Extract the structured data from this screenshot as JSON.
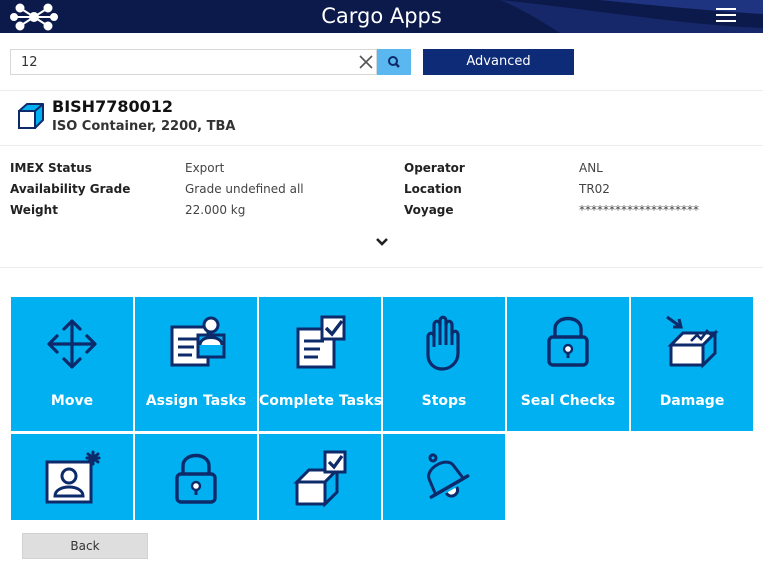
{
  "header": {
    "title": "Cargo Apps"
  },
  "search": {
    "value": "12",
    "advanced_label": "Advanced"
  },
  "unit": {
    "id": "BISH7780012",
    "description": "ISO Container, 2200, TBA"
  },
  "details": {
    "imex_label": "IMEX Status",
    "imex_value": "Export",
    "availability_label": "Availability Grade",
    "availability_value": "Grade undefined all",
    "weight_label": "Weight",
    "weight_value": "22.000 kg",
    "operator_label": "Operator",
    "operator_value": "ANL",
    "location_label": "Location",
    "location_value": "TR02",
    "voyage_label": "Voyage",
    "voyage_value": "********************"
  },
  "tiles": [
    {
      "label": "Move",
      "icon": "move-arrows-icon"
    },
    {
      "label": "Assign Tasks",
      "icon": "assign-tasks-icon"
    },
    {
      "label": "Complete Tasks",
      "icon": "complete-tasks-icon"
    },
    {
      "label": "Stops",
      "icon": "stop-hand-icon"
    },
    {
      "label": "Seal Checks",
      "icon": "padlock-icon"
    },
    {
      "label": "Damage",
      "icon": "damaged-container-icon"
    },
    {
      "label": "",
      "icon": "person-badge-icon"
    },
    {
      "label": "",
      "icon": "padlock-icon"
    },
    {
      "label": "",
      "icon": "container-check-icon"
    },
    {
      "label": "",
      "icon": "alarm-bell-icon"
    }
  ],
  "footer": {
    "back_label": "Back"
  },
  "colors": {
    "header_bg": "#0c1a4b",
    "tile_bg": "#00b0f0",
    "advanced_bg": "#0e2b78",
    "search_btn": "#5ab7ef",
    "icon_stroke": "#0d2a6b"
  }
}
